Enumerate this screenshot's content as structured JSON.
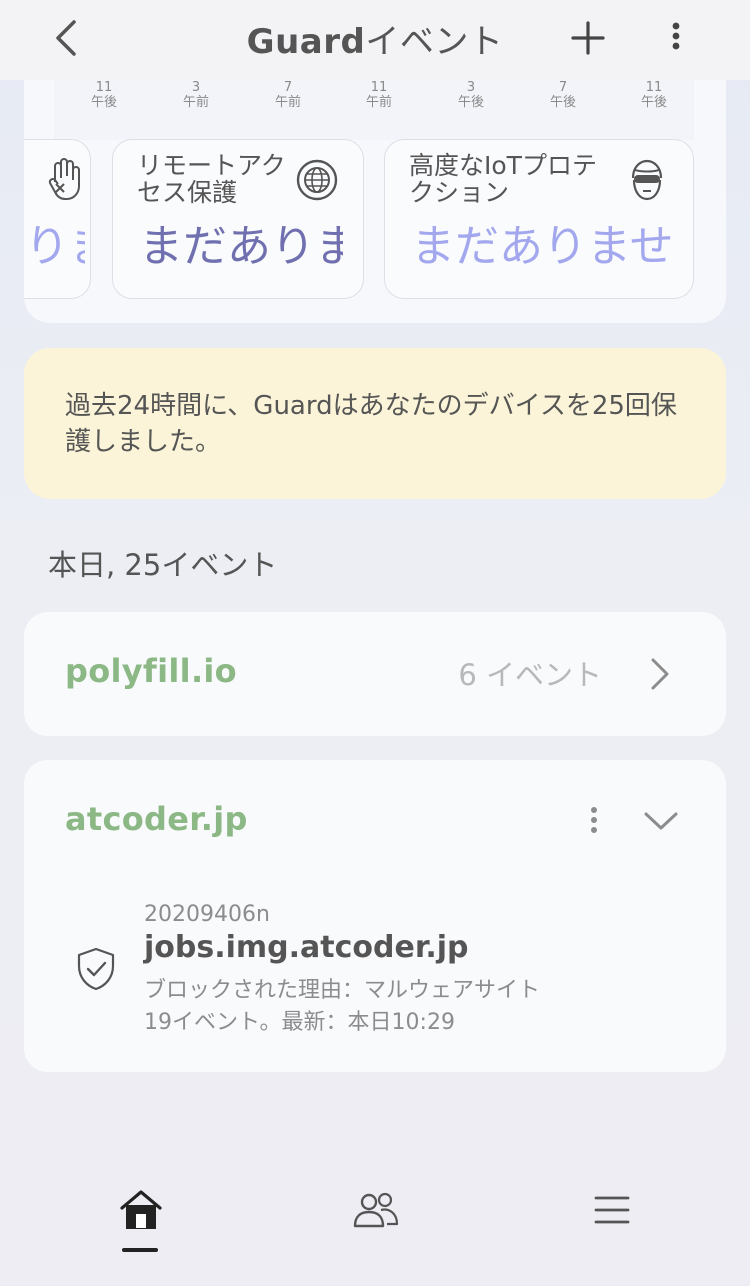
{
  "header": {
    "title_brand": "Guard",
    "title_rest": "イベント"
  },
  "chart_ticks": [
    {
      "num": "11",
      "period": "午後"
    },
    {
      "num": "3",
      "period": "午前"
    },
    {
      "num": "7",
      "period": "午前"
    },
    {
      "num": "11",
      "period": "午前"
    },
    {
      "num": "3",
      "period": "午後"
    },
    {
      "num": "7",
      "period": "午後"
    },
    {
      "num": "11",
      "period": "午後"
    }
  ],
  "protections": [
    {
      "label": "",
      "value": "りま",
      "icon": "hand-block-icon",
      "color": "#a3a8ee"
    },
    {
      "label": "リモートアクセス保護",
      "value": "まだありま",
      "icon": "globe-icon",
      "color": "#7070b0"
    },
    {
      "label": "高度なIoTプロテクション",
      "value": "まだありません",
      "icon": "masked-face-icon",
      "color": "#a3a8ee"
    }
  ],
  "notice": {
    "text": "過去24時間に、Guardはあなたのデバイスを25回保護しました。"
  },
  "today_summary": "本日, 25イベント",
  "sites": [
    {
      "name": "polyfill.io",
      "count": "6 イベント"
    },
    {
      "name": "atcoder.jp",
      "event": {
        "device": "20209406n",
        "domain": "jobs.img.atcoder.jp",
        "reason": "ブロックされた理由：マルウェアサイト",
        "summary": "19イベント。最新：本日10:29"
      }
    }
  ],
  "colors": {
    "site_green": "#8cb886",
    "notice_bg": "#fbf4d8",
    "value_purple": "#7070b0",
    "value_lavender": "#a3a8ee"
  },
  "nav": {
    "items": [
      "home-icon",
      "people-icon",
      "menu-icon"
    ],
    "active": "home-icon"
  }
}
